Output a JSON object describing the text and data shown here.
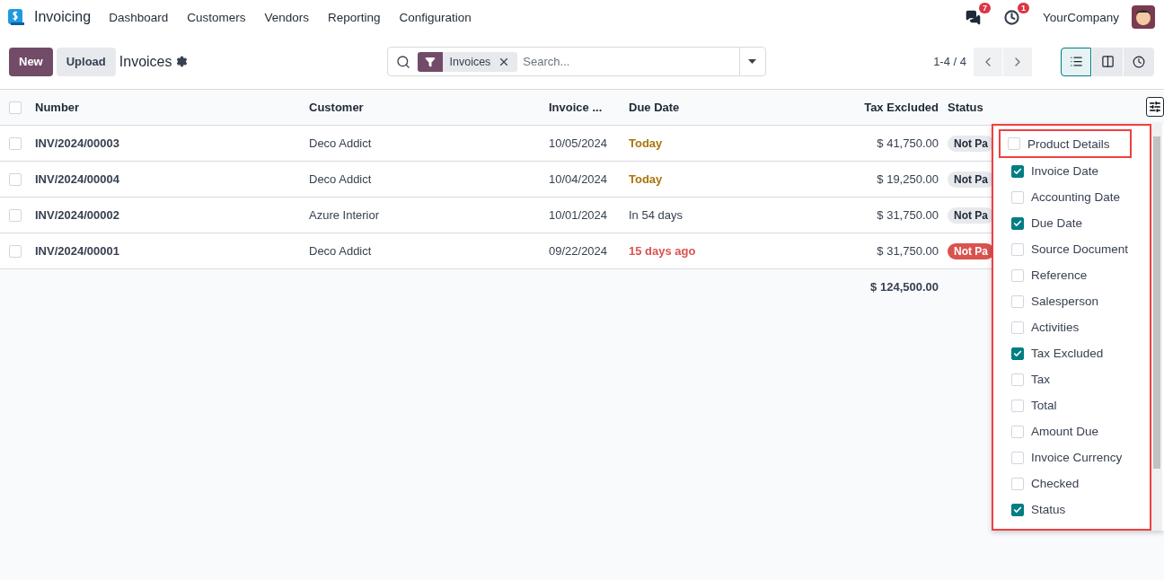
{
  "navbar": {
    "app_name": "Invoicing",
    "menu": [
      "Dashboard",
      "Customers",
      "Vendors",
      "Reporting",
      "Configuration"
    ],
    "messages_count": "7",
    "activities_count": "1",
    "company": "YourCompany"
  },
  "control_panel": {
    "buttons": [
      "New",
      "Upload"
    ],
    "title": "Invoices",
    "facet": "Invoices",
    "search_placeholder": "Search...",
    "pager": "1-4 / 4",
    "views": [
      {
        "kind": "list",
        "selected": true
      },
      {
        "kind": "kanban",
        "selected": false
      },
      {
        "kind": "activity",
        "selected": false
      }
    ]
  },
  "table": {
    "all_checked": false,
    "columns": [
      "Number",
      "Customer",
      "Invoice ...",
      "Due Date",
      "Tax Excluded",
      "Status"
    ],
    "rows": [
      {
        "checked": false,
        "number": "INV/2024/00003",
        "customer": "Deco Addict",
        "invoice_date": "10/05/2024",
        "due_date": {
          "text": "Today",
          "color": "#a8760b"
        },
        "tax_excluded": "$ 41,750.00",
        "status": {
          "text": "Not Pa",
          "color": "#e7e9ed"
        }
      },
      {
        "checked": false,
        "number": "INV/2024/00004",
        "customer": "Deco Addict",
        "invoice_date": "10/04/2024",
        "due_date": {
          "text": "Today",
          "color": "#a8760b"
        },
        "tax_excluded": "$ 19,250.00",
        "status": {
          "text": "Not Pa",
          "color": "#e7e9ed"
        }
      },
      {
        "checked": false,
        "number": "INV/2024/00002",
        "customer": "Azure Interior",
        "invoice_date": "10/01/2024",
        "due_date": {
          "text": "In 54 days",
          "color": "#374151"
        },
        "tax_excluded": "$ 31,750.00",
        "status": {
          "text": "Not Pa",
          "color": "#e7e9ed"
        }
      },
      {
        "checked": false,
        "number": "INV/2024/00001",
        "customer": "Deco Addict",
        "invoice_date": "09/22/2024",
        "due_date": {
          "text": "15 days ago",
          "color": "#d9534f"
        },
        "tax_excluded": "$ 31,750.00",
        "status": {
          "text": "Not Pa",
          "color": "#d9534f"
        }
      }
    ],
    "total": "$ 124,500.00"
  },
  "column_menu": {
    "highlighted": true,
    "items": [
      {
        "label": "Product Details",
        "checked": false,
        "highlighted": true
      },
      {
        "label": "Invoice Date",
        "checked": true,
        "highlighted": false
      },
      {
        "label": "Accounting Date",
        "checked": false,
        "highlighted": false
      },
      {
        "label": "Due Date",
        "checked": true,
        "highlighted": false
      },
      {
        "label": "Source Document",
        "checked": false,
        "highlighted": false
      },
      {
        "label": "Reference",
        "checked": false,
        "highlighted": false
      },
      {
        "label": "Salesperson",
        "checked": false,
        "highlighted": false
      },
      {
        "label": "Activities",
        "checked": false,
        "highlighted": false
      },
      {
        "label": "Tax Excluded",
        "checked": true,
        "highlighted": false
      },
      {
        "label": "Tax",
        "checked": false,
        "highlighted": false
      },
      {
        "label": "Total",
        "checked": false,
        "highlighted": false
      },
      {
        "label": "Amount Due",
        "checked": false,
        "highlighted": false
      },
      {
        "label": "Invoice Currency",
        "checked": false,
        "highlighted": false
      },
      {
        "label": "Checked",
        "checked": false,
        "highlighted": false
      },
      {
        "label": "Status",
        "checked": true,
        "highlighted": false
      }
    ]
  }
}
